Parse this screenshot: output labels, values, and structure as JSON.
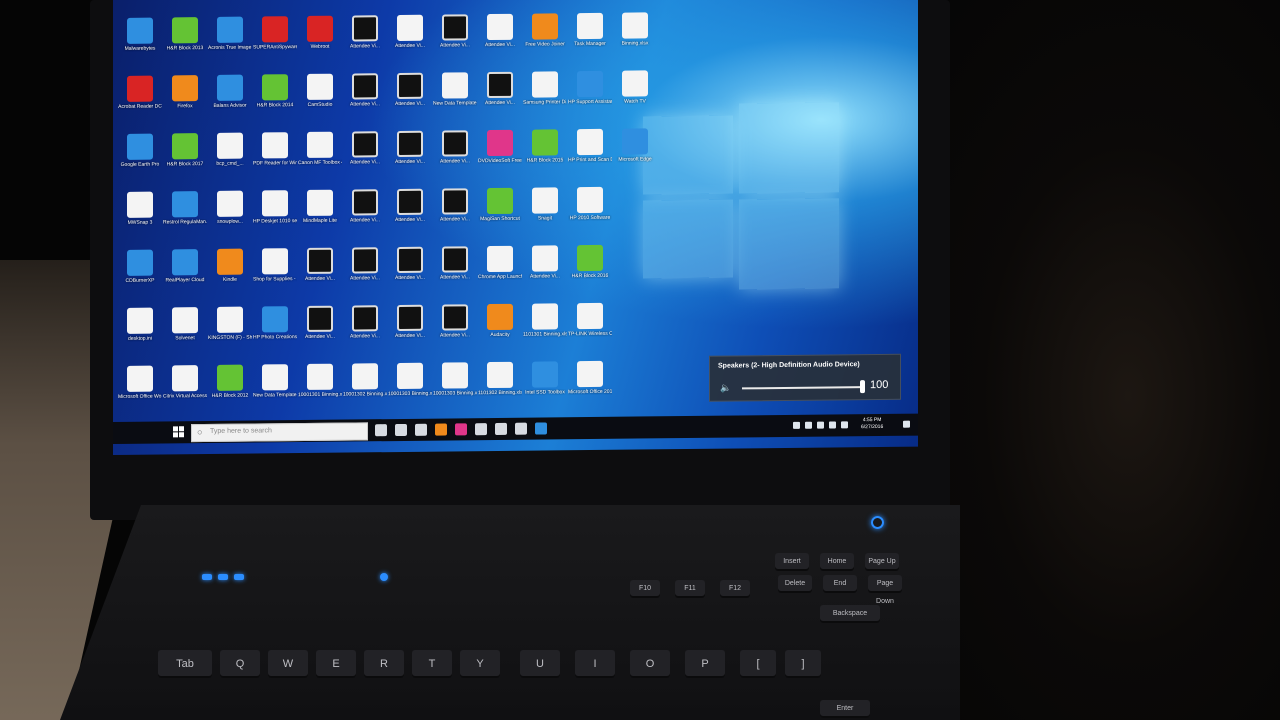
{
  "screen": {
    "desktop_icons": [
      {
        "label": "Malwarebytes",
        "color": "blue"
      },
      {
        "label": "H&R Block 2013",
        "color": "green"
      },
      {
        "label": "Acronis True Image 2015",
        "color": "blue"
      },
      {
        "label": "SUPERAntiSpyware Free Edition",
        "color": "red"
      },
      {
        "label": "Webroot",
        "color": "red"
      },
      {
        "label": "Attendee Vi...",
        "color": "black"
      },
      {
        "label": "Attendee Vi...",
        "color": "white"
      },
      {
        "label": "Attendee Vi...",
        "color": "black"
      },
      {
        "label": "Attendee Vi...",
        "color": "white"
      },
      {
        "label": "Free Video Joiner",
        "color": "orange"
      },
      {
        "label": "Task Manager",
        "color": "white"
      },
      {
        "label": "Binning.xlsx",
        "color": "white"
      },
      {
        "label": "Acrobat Reader DC",
        "color": "red"
      },
      {
        "label": "Firefox",
        "color": "orange"
      },
      {
        "label": "Balans Advisor",
        "color": "blue"
      },
      {
        "label": "H&R Block 2014",
        "color": "green"
      },
      {
        "label": "CamStudio",
        "color": "white"
      },
      {
        "label": "Attendee Vi...",
        "color": "black"
      },
      {
        "label": "Attendee Vi...",
        "color": "black"
      },
      {
        "label": "New Data Template.xlsx",
        "color": "white"
      },
      {
        "label": "Attendee Vi...",
        "color": "black"
      },
      {
        "label": "Samsung Printer Di...",
        "color": "white"
      },
      {
        "label": "HP Support Assistant",
        "color": "blue"
      },
      {
        "label": "Watch TV",
        "color": "white"
      },
      {
        "label": "Google Earth Pro",
        "color": "blue"
      },
      {
        "label": "H&R Block 2017",
        "color": "green"
      },
      {
        "label": "bcp_cmd_...",
        "color": "white"
      },
      {
        "label": "PDF Reader for Windo...",
        "color": "white"
      },
      {
        "label": "Canon MF Toolbox 4.9",
        "color": "white"
      },
      {
        "label": "Attendee Vi...",
        "color": "black"
      },
      {
        "label": "Attendee Vi...",
        "color": "black"
      },
      {
        "label": "Attendee Vi...",
        "color": "black"
      },
      {
        "label": "DVDVideoSoft Free Studio",
        "color": "pink"
      },
      {
        "label": "H&R Block 2015",
        "color": "green"
      },
      {
        "label": "HP Print and Scan Doctor",
        "color": "white"
      },
      {
        "label": "Microsoft Edge",
        "color": "blue"
      },
      {
        "label": "MWSnap 3",
        "color": "white"
      },
      {
        "label": "Restrol RegulaMan...",
        "color": "blue"
      },
      {
        "label": "snowplow...",
        "color": "white"
      },
      {
        "label": "HP Deskjet 1010 series",
        "color": "white"
      },
      {
        "label": "MindMaple Lite",
        "color": "white"
      },
      {
        "label": "Attendee Vi...",
        "color": "black"
      },
      {
        "label": "Attendee Vi...",
        "color": "black"
      },
      {
        "label": "Attendee Vi...",
        "color": "black"
      },
      {
        "label": "MagiSan Shortcut",
        "color": "green"
      },
      {
        "label": "Snagit",
        "color": "white"
      },
      {
        "label": "HP 2010 Software",
        "color": "white"
      },
      {
        "label": "CDBurnerXP",
        "color": "blue"
      },
      {
        "label": "RealPlayer Cloud",
        "color": "blue"
      },
      {
        "label": "Kindle",
        "color": "orange"
      },
      {
        "label": "Shop for Supplies - ...",
        "color": "white"
      },
      {
        "label": "Attendee Vi...",
        "color": "black"
      },
      {
        "label": "Attendee Vi...",
        "color": "black"
      },
      {
        "label": "Attendee Vi...",
        "color": "black"
      },
      {
        "label": "Attendee Vi...",
        "color": "black"
      },
      {
        "label": "Chrome App Launcher",
        "color": "white"
      },
      {
        "label": "Attendee Vi...",
        "color": "white"
      },
      {
        "label": "H&R Block 2016",
        "color": "green"
      },
      {
        "label": "desktop.ini",
        "color": "white"
      },
      {
        "label": "Solvenet",
        "color": "white"
      },
      {
        "label": "KINGSTON (F) - Shortcut",
        "color": "white"
      },
      {
        "label": "HP Photo Creations",
        "color": "blue"
      },
      {
        "label": "Attendee Vi...",
        "color": "black"
      },
      {
        "label": "Attendee Vi...",
        "color": "black"
      },
      {
        "label": "Attendee Vi...",
        "color": "black"
      },
      {
        "label": "Attendee Vi...",
        "color": "black"
      },
      {
        "label": "Audacity",
        "color": "orange"
      },
      {
        "label": "1101301 Binning.xlsx",
        "color": "white"
      },
      {
        "label": "TP-LINK Wireless C...",
        "color": "white"
      },
      {
        "label": "Microsoft Office Wo...",
        "color": "white"
      },
      {
        "label": "Citrix Virtual Access",
        "color": "white"
      },
      {
        "label": "H&R Block 2012",
        "color": "green"
      },
      {
        "label": "New Data Template.xlsx",
        "color": "white"
      },
      {
        "label": "10001301 Binning.xlsx",
        "color": "white"
      },
      {
        "label": "10001302 Binning.xlsx",
        "color": "white"
      },
      {
        "label": "10001303 Binning.xlsx",
        "color": "white"
      },
      {
        "label": "10001303 Binning.xlsx",
        "color": "white"
      },
      {
        "label": "1101302 Binning.xlsx",
        "color": "white"
      },
      {
        "label": "Intel SSD Toolbox",
        "color": "blue"
      },
      {
        "label": "Microsoft Office 2010",
        "color": "white"
      }
    ],
    "volume_flyout": {
      "device": "Speakers (2- High Definition Audio Device)",
      "level": 100,
      "level_text": "100"
    },
    "taskbar": {
      "search_placeholder": "Type here to search",
      "time": "4:55 PM",
      "date": "6/27/2016"
    }
  },
  "keyboard": {
    "top_row": [
      "F10",
      "F11",
      "F12"
    ],
    "nav_keys": [
      "Insert",
      "Home",
      "Page Up",
      "Delete",
      "End",
      "Page Down"
    ],
    "letters_row": [
      "Tab",
      "Q",
      "W",
      "E",
      "R",
      "T",
      "Y",
      "U",
      "I",
      "O",
      "P",
      "[",
      "]"
    ],
    "backspace": "Backspace",
    "enter": "Enter"
  },
  "colors": {
    "led_blue": "#2b8dff",
    "wallpaper_blue": "#1c7fd6"
  }
}
